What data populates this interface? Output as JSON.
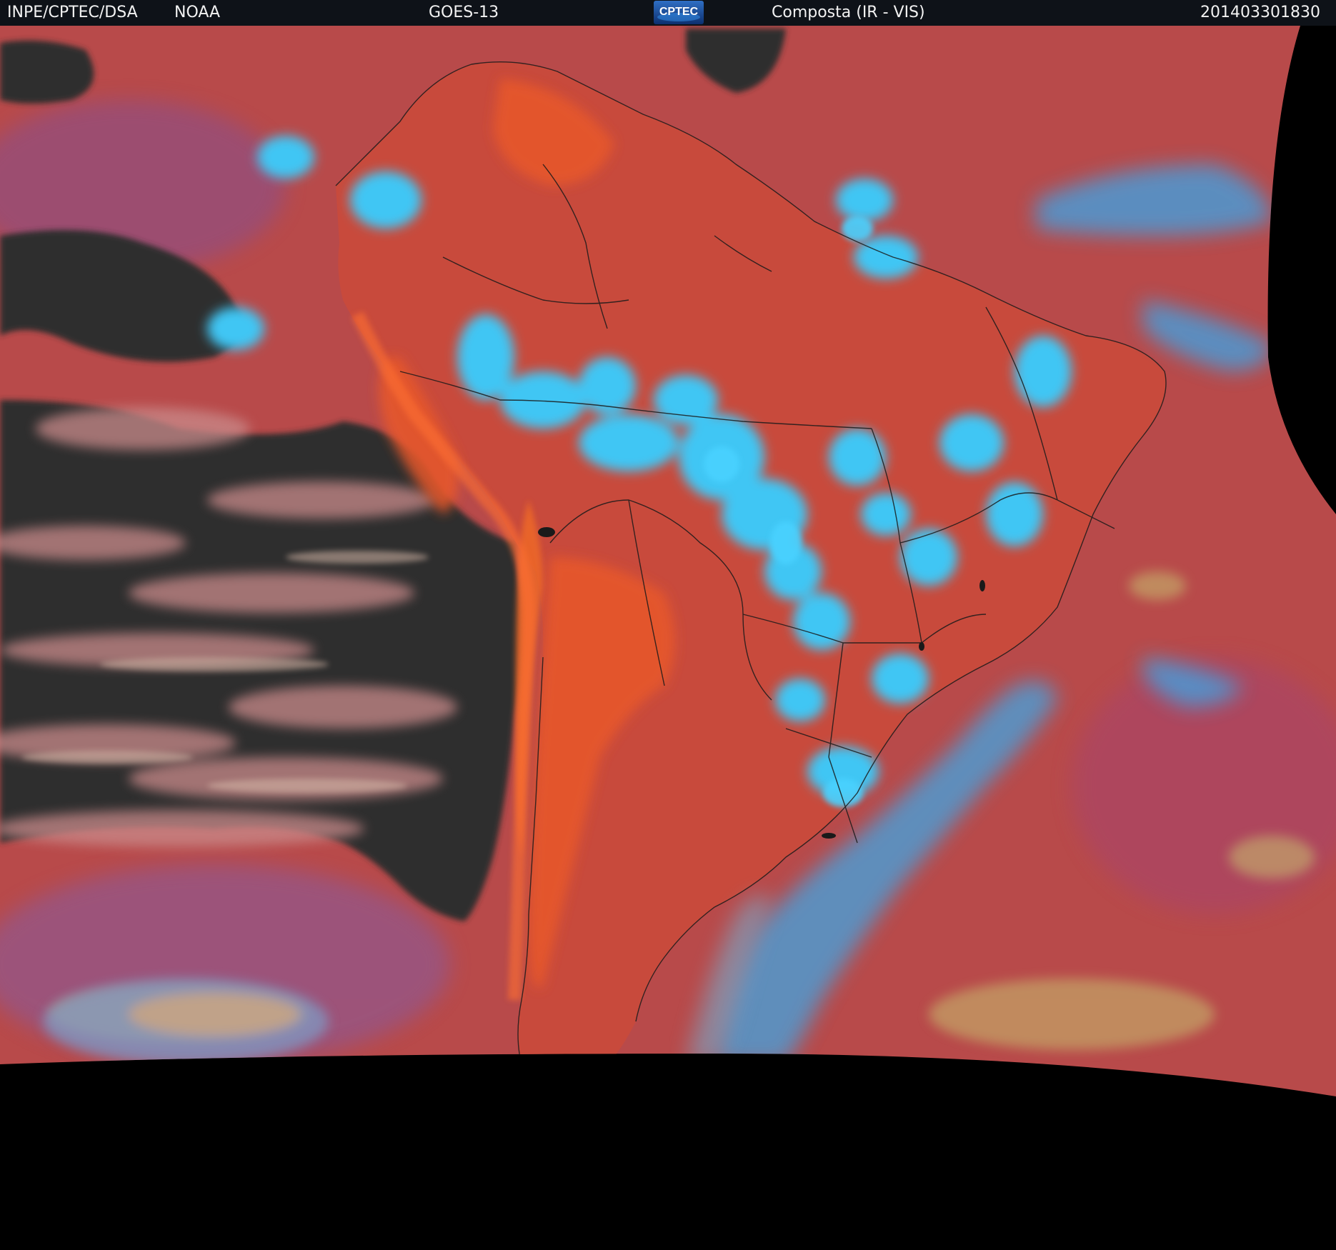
{
  "header": {
    "agency": "INPE/CPTEC/DSA",
    "source": "NOAA",
    "satellite": "GOES-13",
    "logo_text": "CPTEC",
    "product": "Composta (IR - VIS)",
    "timestamp": "201403301830"
  },
  "colors": {
    "header_background": "#0e1218",
    "ocean_clear": "#b84a4a",
    "land_warm": "#e0552a",
    "high_cloud": "#44c8f5",
    "low_cloud": "#b0b89a",
    "low_stratus": "#2a2a2a",
    "space": "#000000",
    "borders": "#1a1a1a"
  }
}
